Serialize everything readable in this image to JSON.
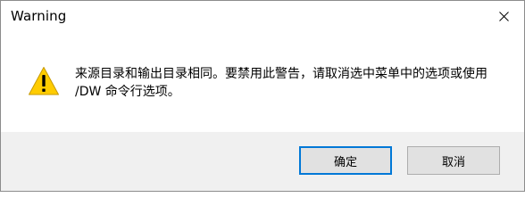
{
  "window": {
    "title": "Warning"
  },
  "icons": {
    "close": "close-icon",
    "warning": "warning-icon"
  },
  "message": {
    "line1": "来源目录和输出目录相同。要禁用此警告，请取消选中菜单中的选项或使用",
    "line2": "/DW 命令行选项。"
  },
  "buttons": {
    "ok_label": "确定",
    "cancel_label": "取消"
  },
  "colors": {
    "warning_fill": "#ffcc00",
    "default_button_border": "#0078d7",
    "footer_bg": "#f0f0f0"
  }
}
